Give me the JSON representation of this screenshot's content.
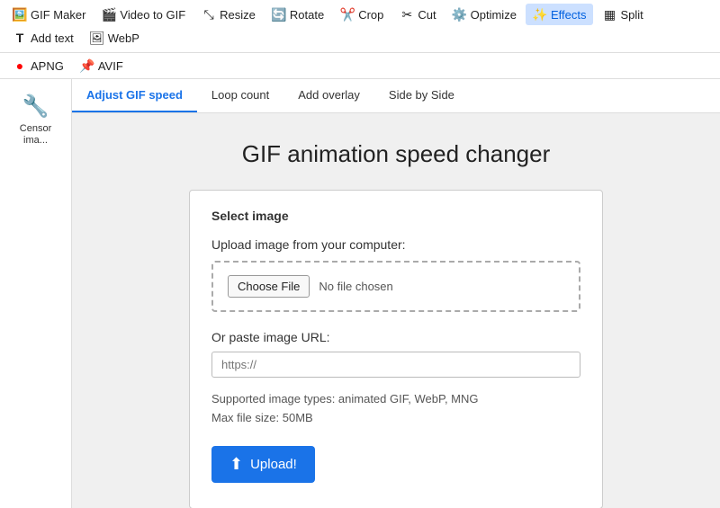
{
  "toolbar": {
    "items": [
      {
        "id": "gif-maker",
        "label": "GIF Maker",
        "icon": "🖼️",
        "active": false
      },
      {
        "id": "video-to-gif",
        "label": "Video to GIF",
        "icon": "🎬",
        "active": false
      },
      {
        "id": "resize",
        "label": "Resize",
        "icon": "⤡",
        "active": false
      },
      {
        "id": "rotate",
        "label": "Rotate",
        "icon": "🔄",
        "active": false
      },
      {
        "id": "crop",
        "label": "Crop",
        "icon": "✂️",
        "active": false
      },
      {
        "id": "cut",
        "label": "Cut",
        "icon": "✂",
        "active": false
      },
      {
        "id": "optimize",
        "label": "Optimize",
        "icon": "⚙️",
        "active": false
      },
      {
        "id": "effects",
        "label": "Effects",
        "icon": "✨",
        "active": true
      },
      {
        "id": "split",
        "label": "Split",
        "icon": "▦",
        "active": false
      },
      {
        "id": "add-text",
        "label": "Add text",
        "icon": "T",
        "active": false
      },
      {
        "id": "webp",
        "label": "WebP",
        "icon": "🖼",
        "active": false
      }
    ]
  },
  "toolbar2": {
    "items": [
      {
        "id": "apng",
        "label": "APNG",
        "icon": "🔴",
        "active": false
      },
      {
        "id": "avif",
        "label": "AVIF",
        "icon": "📌",
        "active": false
      }
    ]
  },
  "tabs": [
    {
      "id": "adjust-speed",
      "label": "Adjust GIF speed",
      "active": true
    },
    {
      "id": "loop-count",
      "label": "Loop count",
      "active": false
    },
    {
      "id": "add-overlay",
      "label": "Add overlay",
      "active": false
    },
    {
      "id": "side-by-side",
      "label": "Side by Side",
      "active": false
    }
  ],
  "sidebar": {
    "items": [
      {
        "id": "censor-image",
        "label": "Censor ima...",
        "icon": "🔧"
      }
    ]
  },
  "main": {
    "page_title": "GIF animation speed changer",
    "card": {
      "section_title": "Select image",
      "upload_label": "Upload image from your computer:",
      "choose_file_label": "Choose File",
      "no_file_text": "No file chosen",
      "url_label": "Or paste image URL:",
      "url_placeholder": "https://",
      "supported_text": "Supported image types: animated GIF, WebP, MNG",
      "max_size_text": "Max file size: 50MB",
      "upload_button_label": "Upload!"
    }
  }
}
